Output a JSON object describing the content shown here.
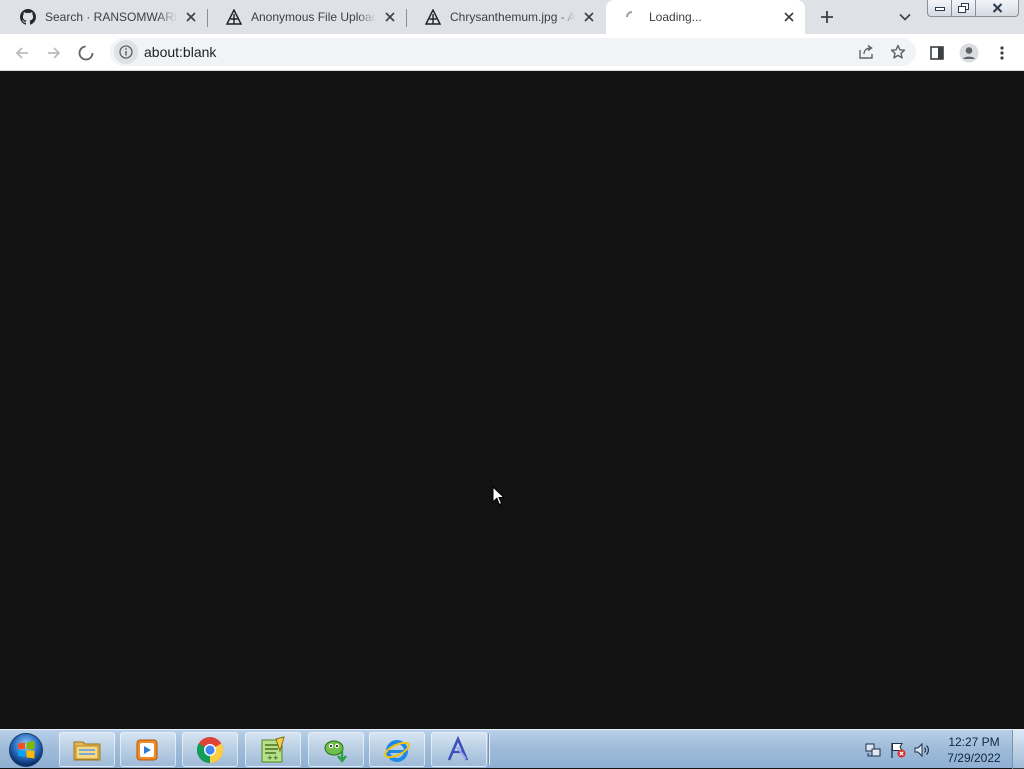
{
  "browser": {
    "tabs": [
      {
        "title": "Search · RANSOMWARE F",
        "favicon": "github-icon",
        "active": false
      },
      {
        "title": "Anonymous File Upload -",
        "favicon": "anonfiles-icon",
        "active": false
      },
      {
        "title": "Chrysanthemum.jpg - An",
        "favicon": "anonfiles-icon",
        "active": false
      },
      {
        "title": "Loading...",
        "favicon": "loading-spinner-icon",
        "active": true
      }
    ],
    "address_bar": {
      "url": "about:blank"
    },
    "page_background": "#121212"
  },
  "taskbar": {
    "pinned": [
      {
        "name": "file-explorer-icon"
      },
      {
        "name": "media-player-icon"
      },
      {
        "name": "chrome-icon"
      },
      {
        "name": "notepad-plus-plus-icon"
      },
      {
        "name": "download-app-icon"
      },
      {
        "name": "internet-explorer-icon"
      },
      {
        "name": "app-icon"
      }
    ],
    "clock": {
      "time": "12:27 PM",
      "date": "7/29/2022"
    }
  }
}
